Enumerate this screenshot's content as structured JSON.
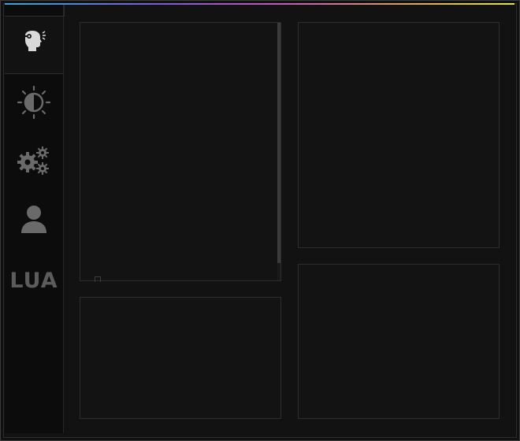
{
  "sidebar": {
    "tabs": [
      {
        "id": "rage",
        "icon": "head-aim-icon",
        "active": true
      },
      {
        "id": "visuals",
        "icon": "brightness-icon",
        "active": false
      },
      {
        "id": "misc",
        "icon": "gears-icon",
        "active": false
      },
      {
        "id": "players",
        "icon": "user-icon",
        "active": false
      },
      {
        "id": "lua",
        "label": "LUA",
        "active": false
      }
    ]
  },
  "colors": {
    "accent_gradient": [
      "#3aa7d6",
      "#7b5cd6",
      "#c65ab8",
      "#d7a06a",
      "#e0e64a"
    ],
    "background": "#121212",
    "panel_border": "#2d2d2d",
    "icon_active": "#d9d9d9",
    "icon_inactive": "#6a6a6a"
  },
  "panels": {
    "top_left": {
      "cut_item_text": ""
    },
    "bottom_left": {},
    "top_right": {},
    "bottom_right": {}
  }
}
